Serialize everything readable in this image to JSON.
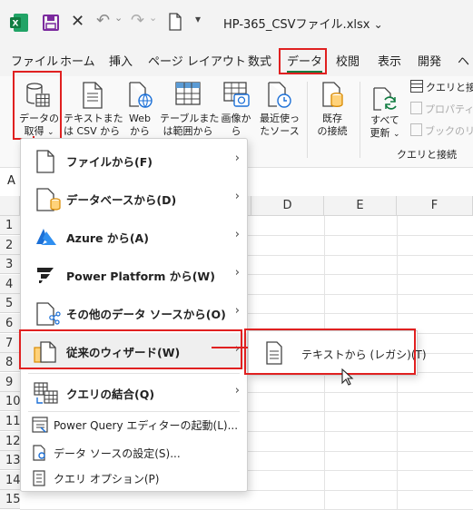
{
  "title": {
    "filename": "HP-365_CSVファイル.xlsx",
    "dropdown": "⌄"
  },
  "tabs": [
    "ファイル",
    "ホーム",
    "挿入",
    "ページ レイアウト",
    "数式",
    "データ",
    "校閲",
    "表示",
    "開発",
    "ヘ"
  ],
  "ribbon": {
    "get_data": {
      "line1": "データの",
      "line2": "取得"
    },
    "text_csv": {
      "line1": "テキストまた",
      "line2": "は CSV から"
    },
    "web": {
      "line1": "Web",
      "line2": "から"
    },
    "table_range": {
      "line1": "テーブルまた",
      "line2": "は範囲から"
    },
    "image": {
      "line1": "画像か",
      "line2": "ら"
    },
    "recent": {
      "line1": "最近使っ",
      "line2": "たソース"
    },
    "existing": {
      "line1": "既存",
      "line2": "の接続"
    },
    "refresh_all": {
      "line1": "すべて",
      "line2": "更新"
    },
    "queries_connections": "クエリと接続",
    "properties": "プロパティ",
    "book_links": "ブックのリン",
    "group_label": "クエリと接続"
  },
  "name_box": "A",
  "columns": [
    "D",
    "E",
    "F"
  ],
  "rows": [
    "1",
    "2",
    "3",
    "4",
    "5",
    "6",
    "7",
    "8",
    "9",
    "10",
    "11",
    "12",
    "13",
    "14",
    "15"
  ],
  "menu": {
    "items": [
      {
        "label": "ファイルから(F)"
      },
      {
        "label": "データベースから(D)"
      },
      {
        "label": "Azure から(A)"
      },
      {
        "label": "Power Platform から(W)"
      },
      {
        "label": "その他のデータ ソースから(O)"
      },
      {
        "label": "従来のウィザード(W)"
      },
      {
        "label": "クエリの結合(Q)"
      }
    ],
    "plain_items": [
      {
        "label": "Power Query エディターの起動(L)..."
      },
      {
        "label": "データ ソースの設定(S)..."
      },
      {
        "label": "クエリ オプション(P)"
      }
    ]
  },
  "submenu": {
    "label": "テキストから (レガシ)(T)"
  },
  "colors": {
    "accent_red": "#e02020",
    "excel_green": "#107c41",
    "azure_blue": "#1b6fd6"
  }
}
